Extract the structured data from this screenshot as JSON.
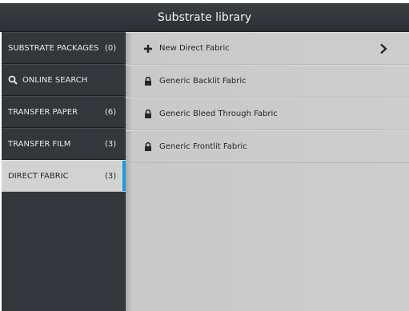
{
  "header": {
    "title": "Substrate library"
  },
  "sidebar": {
    "items": [
      {
        "label": "SUBSTRATE PACKAGES",
        "count": "(0)"
      },
      {
        "label": "ONLINE SEARCH",
        "icon": "search-icon"
      },
      {
        "label": "TRANSFER PAPER",
        "count": "(6)"
      },
      {
        "label": "TRANSFER FILM",
        "count": "(3)"
      },
      {
        "label": "DIRECT FABRIC",
        "count": "(3)",
        "selected": true
      }
    ]
  },
  "main": {
    "rows": [
      {
        "label": "New Direct Fabric",
        "icon": "plus-icon",
        "action_icon": "chevron-right-icon"
      },
      {
        "label": "Generic Backlit Fabric",
        "icon": "lock-icon"
      },
      {
        "label": "Generic Bleed Through Fabric",
        "icon": "lock-icon"
      },
      {
        "label": "Generic Frontlit Fabric",
        "icon": "lock-icon"
      }
    ]
  },
  "colors": {
    "accent": "#1a9bdc",
    "sidebar_bg": "#33363b",
    "content_bg": "#cdcdcd"
  }
}
